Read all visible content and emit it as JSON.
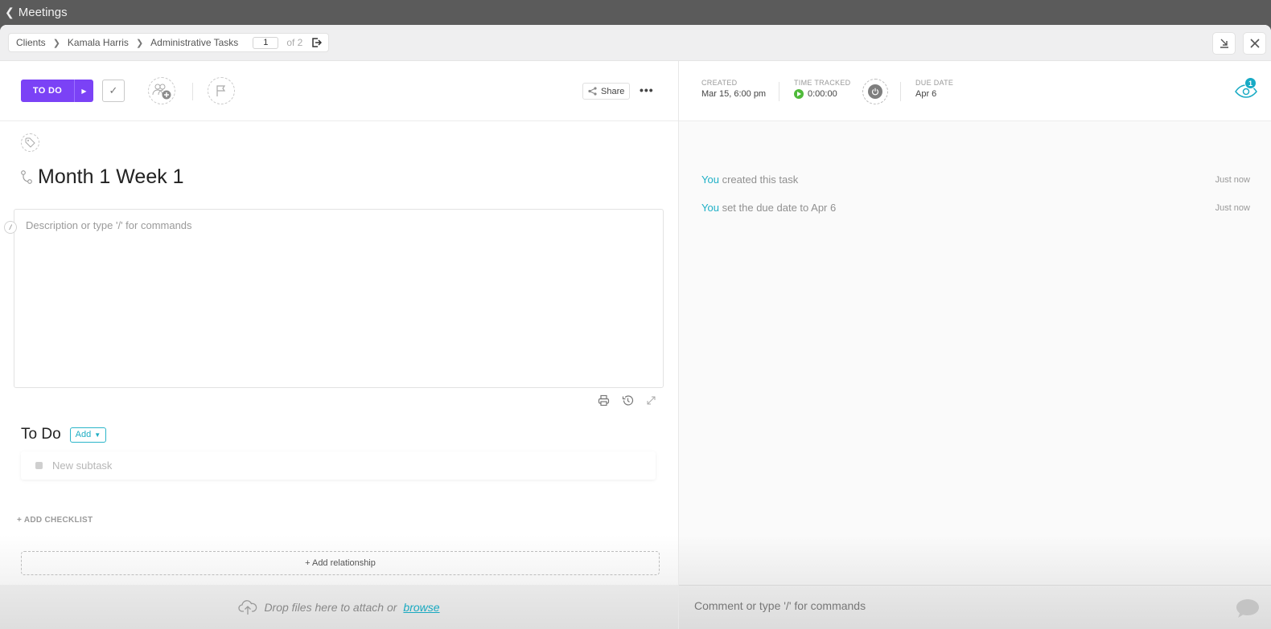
{
  "topbar": {
    "back_label": "Meetings"
  },
  "breadcrumb": {
    "items": [
      "Clients",
      "Kamala Harris",
      "Administrative Tasks"
    ],
    "page_current": "1",
    "page_total_label": "of 2"
  },
  "toolbar": {
    "status_label": "TO DO",
    "share_label": "Share",
    "more_label": "•••",
    "status_color": "#7b42f6"
  },
  "task": {
    "title": "Month 1 Week 1",
    "description_placeholder": "Description or type '/' for commands",
    "slash_hint": "/"
  },
  "subtasks": {
    "section_label": "To Do",
    "add_label": "Add",
    "new_subtask_placeholder": "New subtask",
    "add_checklist_label": "+ ADD CHECKLIST",
    "add_relationship_label": "+ Add relationship"
  },
  "attachments": {
    "drop_text": "Drop files here to attach or",
    "browse_label": "browse"
  },
  "meta": {
    "created_label": "CREATED",
    "created_value": "Mar 15, 6:00 pm",
    "time_tracked_label": "TIME TRACKED",
    "time_tracked_value": "0:00:00",
    "due_date_label": "DUE DATE",
    "due_date_value": "Apr 6",
    "watchers_count": "1"
  },
  "activity": [
    {
      "who": "You",
      "text": "created this task",
      "time": "Just now"
    },
    {
      "who": "You",
      "text": "set the due date to Apr 6",
      "time": "Just now"
    }
  ],
  "comment": {
    "placeholder": "Comment or type '/' for commands"
  },
  "colors": {
    "accent": "#7b42f6",
    "link": "#1fb0c6",
    "play": "#4fba3a"
  }
}
